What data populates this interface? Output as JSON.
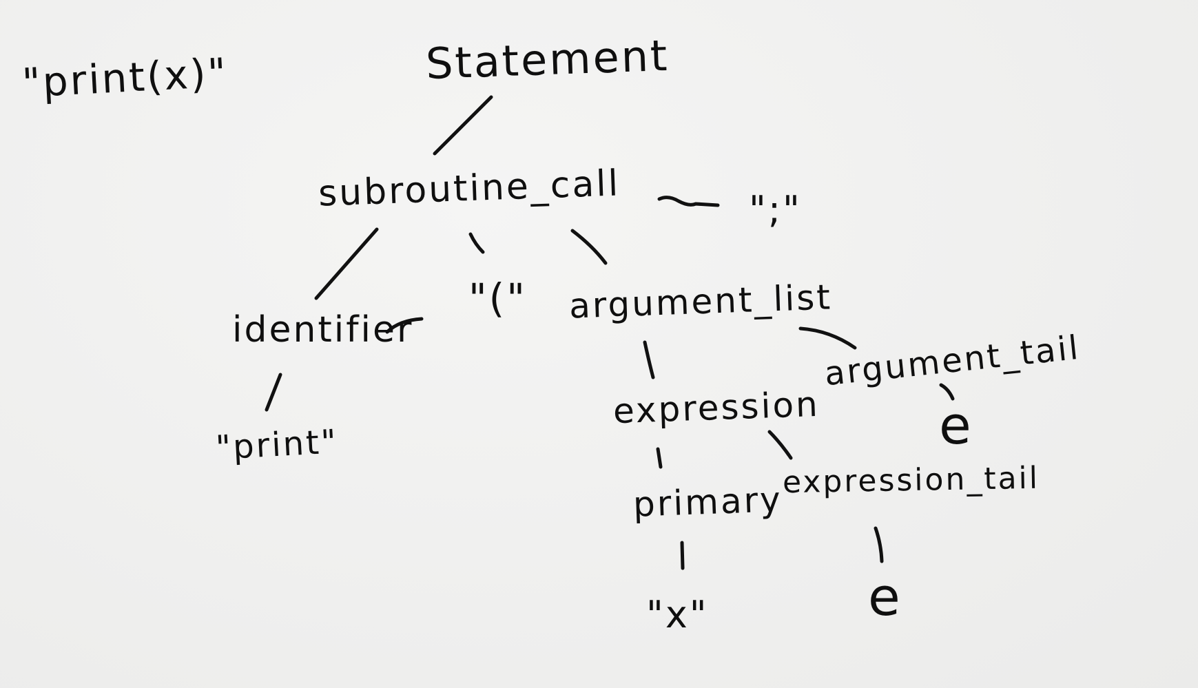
{
  "input_string": "\"print(x)\"",
  "nodes": {
    "statement": "Statement",
    "subroutine_call": "subroutine_call",
    "semicolon": "\";\"",
    "identifier": "identifier",
    "open_paren": "\"(\"",
    "argument_list": "argument_list",
    "print_literal": "\"print\"",
    "expression": "expression",
    "argument_tail": "argument_tail",
    "argument_tail_epsilon": "e",
    "primary": "primary",
    "expression_tail": "expression_tail",
    "x_literal": "\"x\"",
    "expression_tail_epsilon": "e"
  }
}
